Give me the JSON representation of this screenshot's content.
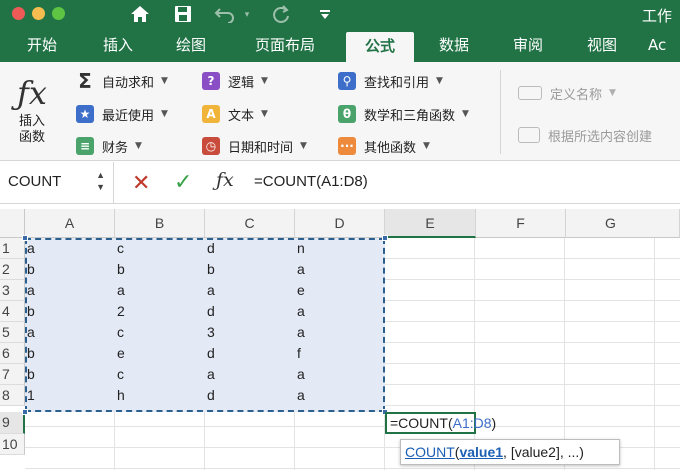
{
  "title": "工作",
  "tabs": [
    "开始",
    "插入",
    "绘图",
    "页面布局",
    "公式",
    "数据",
    "审阅",
    "视图",
    "Ac"
  ],
  "active_tab": "公式",
  "ribbon": {
    "insert_function": {
      "line1": "插入",
      "line2": "函数"
    },
    "col1": [
      "自动求和",
      "最近使用",
      "财务"
    ],
    "col2": [
      "逻辑",
      "文本",
      "日期和时间"
    ],
    "col3": [
      "查找和引用",
      "数学和三角函数",
      "其他函数"
    ],
    "col4": [
      "定义名称",
      "根据所选内容创建"
    ],
    "icon_names": [
      "sigma-icon",
      "star-icon",
      "book-icon",
      "question-icon",
      "text-a-icon",
      "clock-icon",
      "magnifier-icon",
      "theta-icon",
      "dots-icon",
      "tag-icon",
      "create-from-selection-icon"
    ]
  },
  "formula_bar": {
    "name_box": "COUNT",
    "formula": "=COUNT(A1:D8)"
  },
  "grid": {
    "columns": [
      "A",
      "B",
      "C",
      "D",
      "E",
      "F",
      "G"
    ],
    "rows": [
      "1",
      "2",
      "3",
      "4",
      "5",
      "6",
      "7",
      "8",
      "9",
      "10"
    ],
    "data": [
      [
        "a",
        "c",
        "d",
        "n"
      ],
      [
        "b",
        "b",
        "b",
        "a"
      ],
      [
        "a",
        "a",
        "a",
        "e"
      ],
      [
        "b",
        "2",
        "d",
        "a"
      ],
      [
        "a",
        "c",
        "3",
        "a"
      ],
      [
        "b",
        "e",
        "d",
        "f"
      ],
      [
        "b",
        "c",
        "a",
        "a"
      ],
      [
        "1",
        "h",
        "d",
        "a"
      ]
    ],
    "editing_cell": {
      "prefix": "=COUNT(",
      "ref": "A1:D8",
      "suffix": ")"
    }
  },
  "tooltip": {
    "fn": "COUNT",
    "open": "(",
    "arg1": "value1",
    "rest": ", [value2], ...)"
  },
  "colors": {
    "accent": "#217346",
    "range_fill": "#e4e9f6",
    "range_border": "#2b5f8e",
    "link": "#1a5fb4"
  }
}
